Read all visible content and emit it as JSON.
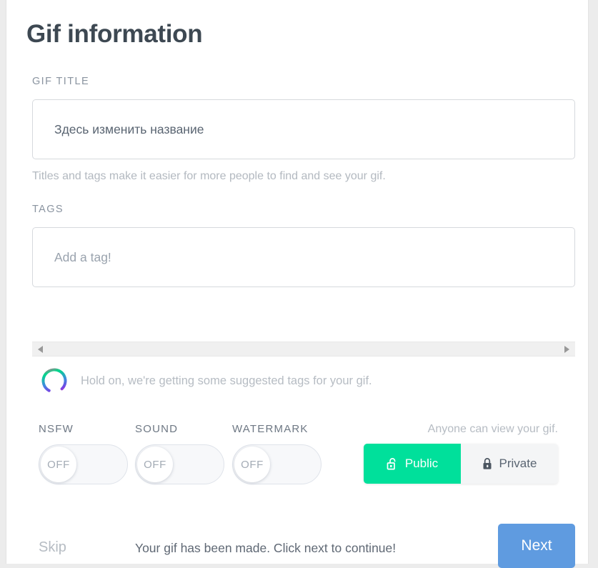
{
  "header": {
    "title": "Gif information"
  },
  "form": {
    "gif_title": {
      "label": "GIF TITLE",
      "value": "Здесь изменить название",
      "placeholder": "Здесь изменить название"
    },
    "helper_text": "Titles and tags make it easier for more people to find and see your gif.",
    "tags": {
      "label": "TAGS",
      "value": "",
      "placeholder": "Add a tag!"
    }
  },
  "scrollbar": {
    "left_arrow_icon": "triangle-left-icon",
    "right_arrow_icon": "triangle-right-icon"
  },
  "loading": {
    "spinner_icon": "loading-spinner-icon",
    "message": "Hold on, we're getting some suggested tags for your gif."
  },
  "toggles": [
    {
      "label": "NSFW",
      "state": "OFF"
    },
    {
      "label": "SOUND",
      "state": "OFF"
    },
    {
      "label": "WATERMARK",
      "state": "OFF"
    }
  ],
  "privacy": {
    "note": "Anyone can view your gif.",
    "public": {
      "label": "Public",
      "icon": "unlock-icon",
      "selected": true
    },
    "private": {
      "label": "Private",
      "icon": "lock-icon",
      "selected": false
    }
  },
  "footer": {
    "skip_label": "Skip",
    "status_message": "Your gif has been made. Click next to continue!",
    "next_label": "Next"
  },
  "colors": {
    "accent_green": "#00e09b",
    "accent_blue": "#5f9be0",
    "text_dark": "#3d4852",
    "text_muted": "#b6bcc3"
  }
}
